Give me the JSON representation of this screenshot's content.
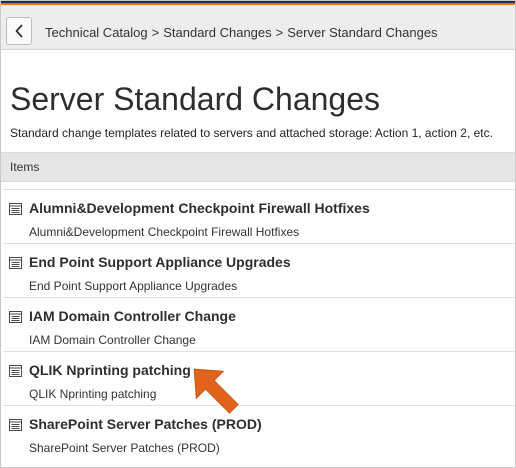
{
  "breadcrumb": {
    "items": [
      "Technical Catalog",
      "Standard Changes",
      "Server Standard Changes"
    ],
    "separator": ">"
  },
  "page": {
    "title": "Server Standard Changes",
    "description": "Standard change templates related to servers and attached storage: Action 1, action 2, etc."
  },
  "items_header": "Items",
  "items": [
    {
      "title": "Alumni&Development Checkpoint Firewall Hotfixes",
      "subtitle": "Alumni&Development Checkpoint Firewall Hotfixes"
    },
    {
      "title": "End Point Support Appliance Upgrades",
      "subtitle": "End Point Support Appliance Upgrades"
    },
    {
      "title": "IAM Domain Controller Change",
      "subtitle": "IAM Domain Controller Change"
    },
    {
      "title": "QLIK Nprinting patching",
      "subtitle": "QLIK Nprinting patching"
    },
    {
      "title": "SharePoint Server Patches (PROD)",
      "subtitle": "SharePoint Server Patches (PROD)"
    }
  ],
  "icons": {
    "back": "chevron-left-icon",
    "item": "list-document-icon",
    "annotation": "arrow-pointer-icon"
  },
  "colors": {
    "accent_navy": "#1c2f4a",
    "accent_orange": "#e8731f",
    "annotation_arrow": "#e2631b"
  }
}
